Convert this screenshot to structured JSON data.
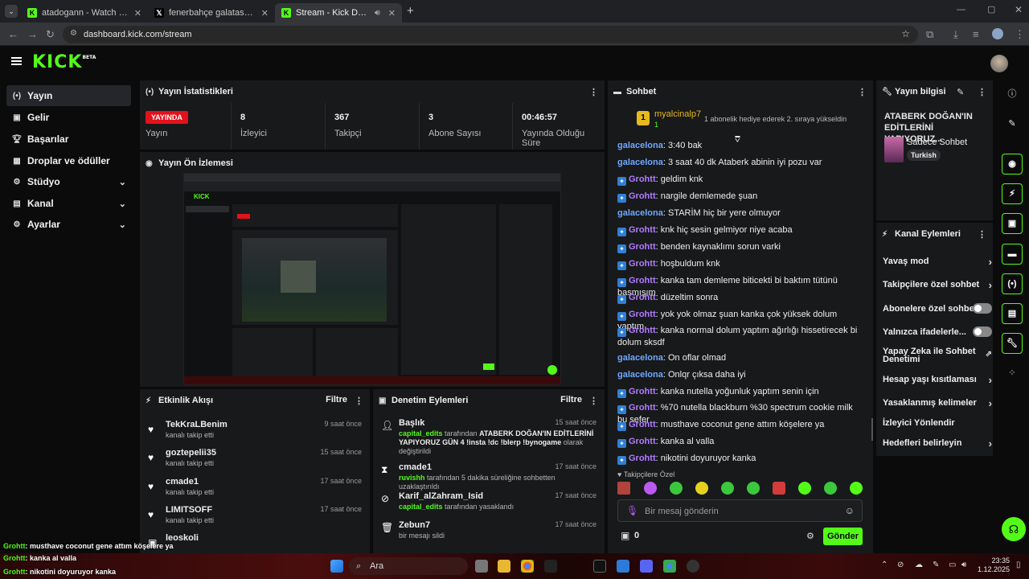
{
  "browser": {
    "tabs": [
      {
        "title": "atadogann - Watch the VOD on",
        "icon": "kick-favicon"
      },
      {
        "title": "fenerbahçe galatasaray - Search",
        "icon": "x-favicon"
      },
      {
        "title": "Stream - Kick Dashboard",
        "icon": "kick-favicon"
      }
    ],
    "url": "dashboard.kick.com/stream"
  },
  "kick": {
    "logo": "KICK",
    "beta": "BETA"
  },
  "sidebar": {
    "items": [
      {
        "label": "Yayın",
        "icon": "broadcast-icon"
      },
      {
        "label": "Gelir",
        "icon": "revenue-icon"
      },
      {
        "label": "Başarılar",
        "icon": "trophy-icon"
      },
      {
        "label": "Droplar ve ödüller",
        "icon": "drops-icon"
      },
      {
        "label": "Stüdyo",
        "icon": "studio-icon"
      },
      {
        "label": "Kanal",
        "icon": "channel-icon"
      },
      {
        "label": "Ayarlar",
        "icon": "gear-icon"
      }
    ]
  },
  "stats": {
    "title": "Yayın İstatistikleri",
    "live_badge": "YAYINDA",
    "items": [
      {
        "value": "",
        "label": "Yayın"
      },
      {
        "value": "8",
        "label": "İzleyici"
      },
      {
        "value": "367",
        "label": "Takipçi"
      },
      {
        "value": "3",
        "label": "Abone Sayısı"
      },
      {
        "value": "00:46:57",
        "label": "Yayında Olduğu Süre"
      }
    ]
  },
  "preview": {
    "title": "Yayın Ön İzlemesi"
  },
  "activity": {
    "title": "Etkinlik Akışı",
    "filter": "Filtre",
    "rows": [
      {
        "name": "TekKraLBenim",
        "sub": "kanalı takip etti",
        "time": "9 saat önce"
      },
      {
        "name": "goztepelii35",
        "sub": "kanalı takip etti",
        "time": "15 saat önce"
      },
      {
        "name": "cmade1",
        "sub": "kanalı takip etti",
        "time": "17 saat önce"
      },
      {
        "name": "LIMITSOFF",
        "sub": "kanalı takip etti",
        "time": "17 saat önce"
      },
      {
        "name": "leoskoli",
        "sub": "",
        "time": ""
      }
    ]
  },
  "moderation": {
    "title": "Denetim Eylemleri",
    "filter": "Filtre",
    "rows": [
      {
        "name": "Başlık",
        "time": "15 saat önce",
        "actor": "capital_edits",
        "mid": " tarafından ",
        "bold": "ATABERK DOĞAN'IN EDİTLERİNİ YAPIYORUZ GÜN 4 !insta !dc !blerp !bynogame",
        "tail": " olarak değiştirildi"
      },
      {
        "name": "cmade1",
        "time": "17 saat önce",
        "actor": "ruvishh",
        "mid": " tarafından 5 dakika süreliğine sohbetten uzaklaştırıldı",
        "bold": "",
        "tail": ""
      },
      {
        "name": "Karif_alZahram_Isid",
        "time": "17 saat önce",
        "actor": "capital_edits",
        "mid": " tarafından yasaklandı",
        "bold": "",
        "tail": ""
      },
      {
        "name": "Zebun7",
        "time": "17 saat önce",
        "actor": "",
        "mid": "bir mesajı sildi",
        "bold": "",
        "tail": ""
      }
    ]
  },
  "chat": {
    "title": "Sohbet",
    "pinned_user": "myalcinalp7",
    "pinned_level": "1",
    "pinned_text": "1 abonelik hediye ederek 2. sıraya yükseldin",
    "messages": [
      {
        "user": "galacelona",
        "text": "3:40 bak",
        "badge": false,
        "color": "#6fa8ff"
      },
      {
        "user": "galacelona",
        "text": "3 saat 40 dk Ataberk abinin iyi pozu var",
        "badge": false,
        "color": "#6fa8ff"
      },
      {
        "user": "Grohtt",
        "text": "geldim knk",
        "badge": true,
        "color": "#b07cff"
      },
      {
        "user": "Grohtt",
        "text": "nargile demlemede şuan",
        "badge": true,
        "color": "#b07cff"
      },
      {
        "user": "galacelona",
        "text": "STARİM hiç bir yere olmuyor",
        "badge": false,
        "color": "#6fa8ff"
      },
      {
        "user": "Grohtt",
        "text": "knk hiç sesin gelmiyor niye acaba",
        "badge": true,
        "color": "#b07cff"
      },
      {
        "user": "Grohtt",
        "text": "benden kaynaklımı sorun varki",
        "badge": true,
        "color": "#b07cff"
      },
      {
        "user": "Grohtt",
        "text": "hoşbuldum knk",
        "badge": true,
        "color": "#b07cff"
      },
      {
        "user": "Grohtt",
        "text": "kanka tam demleme biticekti bi baktım tütünü basmışım",
        "badge": true,
        "color": "#b07cff"
      },
      {
        "user": "Grohtt",
        "text": "düzeltim sonra",
        "badge": true,
        "color": "#b07cff"
      },
      {
        "user": "Grohtt",
        "text": "yok yok olmaz şuan kanka çok yüksek dolum yaptım",
        "badge": true,
        "color": "#b07cff"
      },
      {
        "user": "Grohtt",
        "text": "kanka normal dolum yaptım ağırlığı hissetirecek bi dolum sksdf",
        "badge": true,
        "color": "#b07cff"
      },
      {
        "user": "galacelona",
        "text": "On oflar olmad",
        "badge": false,
        "color": "#6fa8ff"
      },
      {
        "user": "galacelona",
        "text": "Onlqr çıksa daha iyi",
        "badge": false,
        "color": "#6fa8ff"
      },
      {
        "user": "Grohtt",
        "text": "kanka nutella yoğunluk yaptım senin için",
        "badge": true,
        "color": "#b07cff"
      },
      {
        "user": "Grohtt",
        "text": "%70 nutella blackburn %30 spectrum cookie milk bu sefer",
        "badge": true,
        "color": "#b07cff"
      },
      {
        "user": "Grohtt",
        "text": "musthave coconut gene attım köşelere ya",
        "badge": true,
        "color": "#b07cff"
      },
      {
        "user": "Grohtt",
        "text": "kanka al valla",
        "badge": true,
        "color": "#b07cff"
      },
      {
        "user": "Grohtt",
        "text": "nikotini doyuruyor kanka",
        "badge": true,
        "color": "#b07cff"
      }
    ],
    "followers_label": "Takipçilere Özel",
    "input_placeholder": "Bir mesaj gönderin",
    "points": "0",
    "send": "Gönder"
  },
  "info": {
    "title": "Yayın bilgisi",
    "stream_title": "ATABERK DOĞAN'IN EDİTLERİNİ YAPIYORUZ...",
    "category": "Sadece Sohbet",
    "language": "Turkish"
  },
  "actions": {
    "title": "Kanal Eylemleri",
    "items": [
      {
        "label": "Yavaş mod",
        "type": "arrow"
      },
      {
        "label": "Takipçilere özel sohbet",
        "type": "arrow"
      },
      {
        "label": "Abonelere özel sohbet",
        "type": "toggle"
      },
      {
        "label": "Yalnızca ifadelerle...",
        "type": "toggle"
      },
      {
        "label": "Yapay Zeka ile Sohbet Denetimi",
        "type": "external"
      },
      {
        "label": "Hesap yaşı kısıtlaması",
        "type": "arrow"
      },
      {
        "label": "Yasaklanmış kelimeler",
        "type": "arrow"
      },
      {
        "label": "İzleyici Yönlendir",
        "type": "none"
      },
      {
        "label": "Hedefleri belirleyin",
        "type": "arrow"
      }
    ]
  },
  "overlay": [
    {
      "user": "Grohtt",
      "text": ": musthave coconut gene attım köşelere ya"
    },
    {
      "user": "Grohtt",
      "text": ": kanka al valla"
    },
    {
      "user": "Grohtt",
      "text": ": nikotini doyuruyor kanka"
    }
  ],
  "taskbar": {
    "search": "Ara",
    "time": "23:35",
    "date": "1.12.2025"
  },
  "colors": {
    "accent": "#53fc18",
    "live": "#e3111b",
    "panel": "#18191b"
  }
}
